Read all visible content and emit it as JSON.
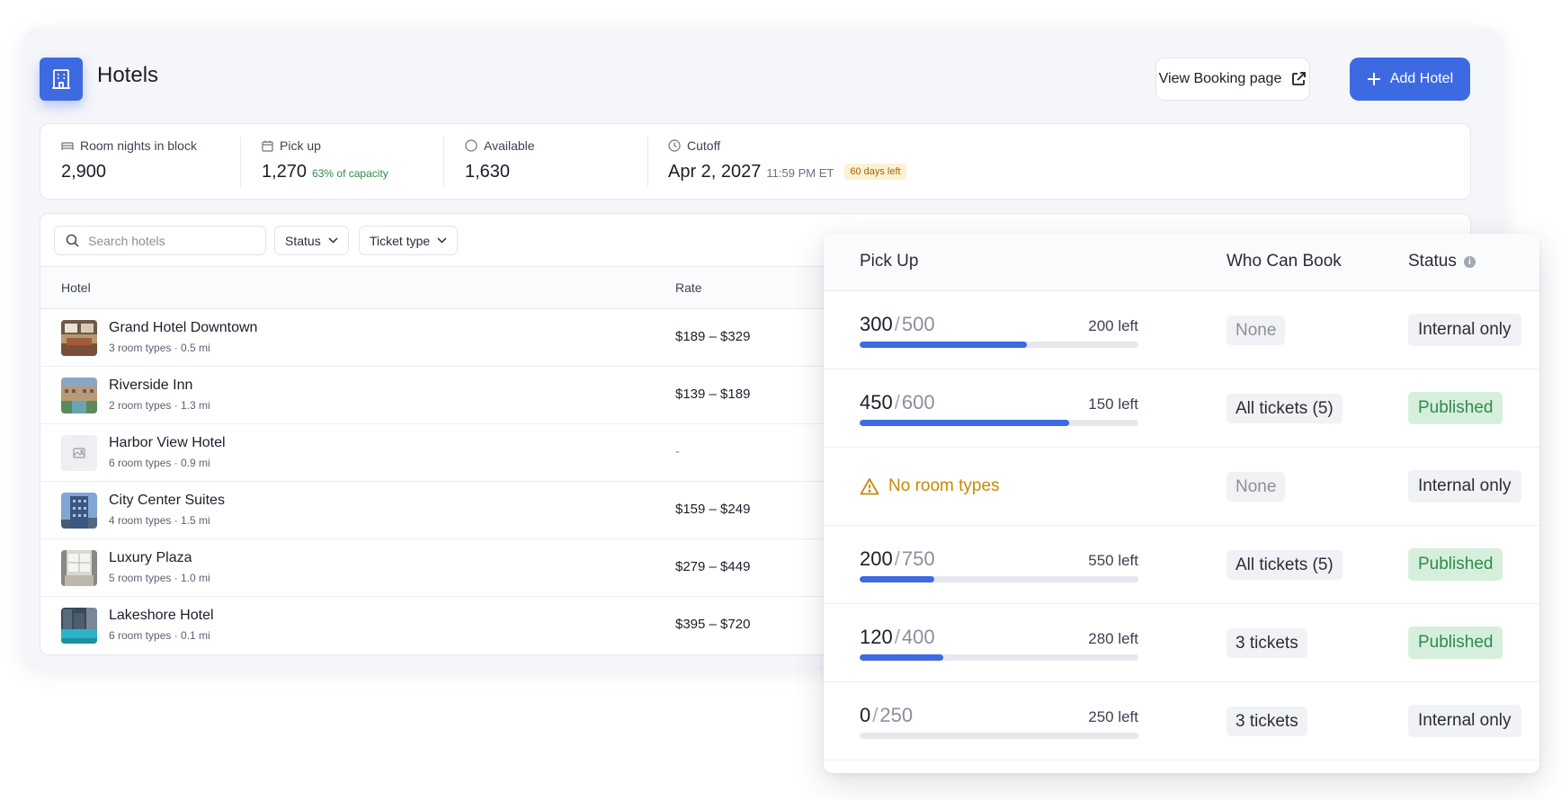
{
  "header": {
    "title": "Hotels",
    "view_booking_label": "View Booking page",
    "add_hotel_label": "Add Hotel"
  },
  "stats": [
    {
      "label": "Room nights in block",
      "value": "2,900",
      "icon": "bed-icon"
    },
    {
      "label": "Pick up",
      "value": "1,270",
      "sub": "63% of capacity",
      "icon": "calendar-icon"
    },
    {
      "label": "Available",
      "value": "1,630",
      "icon": "circle-icon"
    },
    {
      "label": "Cutoff",
      "value": "Apr 2, 2027",
      "sub": "11:59 PM ET",
      "badge": "60 days left",
      "icon": "clock-icon"
    }
  ],
  "filters": {
    "search_placeholder": "Search hotels",
    "status_label": "Status",
    "ticket_type_label": "Ticket type"
  },
  "table": {
    "columns": [
      "Hotel",
      "Rate"
    ],
    "rows": [
      {
        "name": "Grand Hotel Downtown",
        "meta": "3 room types · 0.5 mi",
        "rate": "$189 – $329",
        "thumb": "lobby"
      },
      {
        "name": "Riverside Inn",
        "meta": "2 room types · 1.3 mi",
        "rate": "$139 – $189",
        "thumb": "river"
      },
      {
        "name": "Harbor View Hotel",
        "meta": "6 room types · 0.9 mi",
        "rate": "-",
        "thumb": "placeholder"
      },
      {
        "name": "City Center Suites",
        "meta": "4 room types · 1.5 mi",
        "rate": "$159 – $249",
        "thumb": "tower"
      },
      {
        "name": "Luxury Plaza",
        "meta": "5 room types · 1.0 mi",
        "rate": "$279 – $449",
        "thumb": "room"
      },
      {
        "name": "Lakeshore Hotel",
        "meta": "6 room types · 0.1 mi",
        "rate": "$395 – $720",
        "thumb": "pool"
      }
    ]
  },
  "overlay": {
    "columns": [
      "Pick Up",
      "Who Can Book",
      "Status"
    ],
    "rows": [
      {
        "picked": "300",
        "total": "500",
        "left": "200 left",
        "progress": 0.6,
        "who": "None",
        "status": "Internal only"
      },
      {
        "picked": "450",
        "total": "600",
        "left": "150 left",
        "progress": 0.75,
        "who": "All tickets (5)",
        "status": "Published"
      },
      {
        "warning": "No room types",
        "who": "None",
        "status": "Internal only"
      },
      {
        "picked": "200",
        "total": "750",
        "left": "550 left",
        "progress": 0.2667,
        "who": "All tickets (5)",
        "status": "Published"
      },
      {
        "picked": "120",
        "total": "400",
        "left": "280 left",
        "progress": 0.3,
        "who": "3 tickets",
        "status": "Published"
      },
      {
        "picked": "0",
        "total": "250",
        "left": "250 left",
        "progress": 0,
        "who": "3 tickets",
        "status": "Internal only"
      }
    ]
  },
  "colors": {
    "accent": "#3e6ae1",
    "published_bg": "#d6efdd",
    "published_text": "#2f8a4a",
    "warning": "#c68a0a"
  }
}
